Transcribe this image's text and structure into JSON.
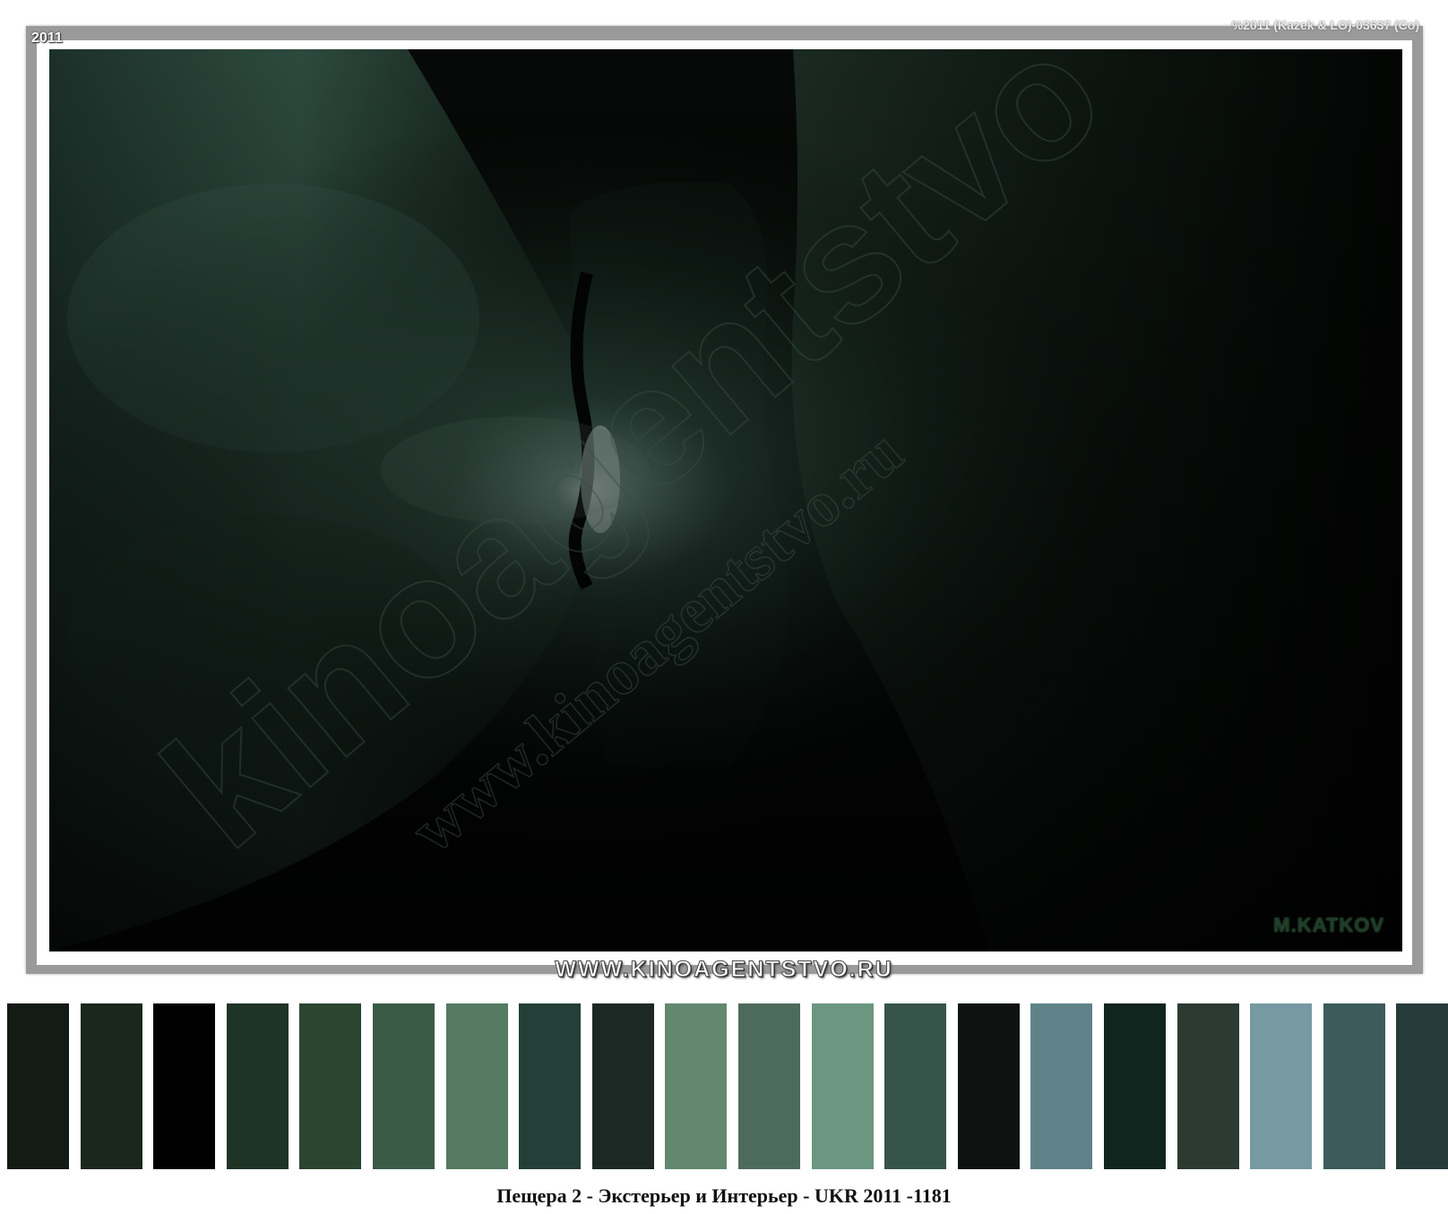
{
  "photo": {
    "year_tag": "2011",
    "copyright": "%2011 (Kazek & LO)-03637 (Co)",
    "signature": "M.KATKOV",
    "watermark_large": "kinoagentstvo",
    "watermark_small": "www.kinoagentstvo.ru"
  },
  "banner": {
    "text": "WWW.KINOAGENTSTVO.RU"
  },
  "palette": {
    "colors": [
      "#141a14",
      "#1b261c",
      "#000000",
      "#203425",
      "#2b4530",
      "#3b5b47",
      "#547a62",
      "#243e38",
      "#1b2824",
      "#628870",
      "#4d6b5d",
      "#6b9780",
      "#37544b",
      "#0e1312",
      "#5f8289",
      "#11251e",
      "#2c3a32",
      "#7799a1",
      "#3d5b5b",
      "#273b3b"
    ]
  },
  "caption": {
    "text": "Пещера 2 - Экстерьер и Интерьер - UKR 2011 -1181"
  }
}
